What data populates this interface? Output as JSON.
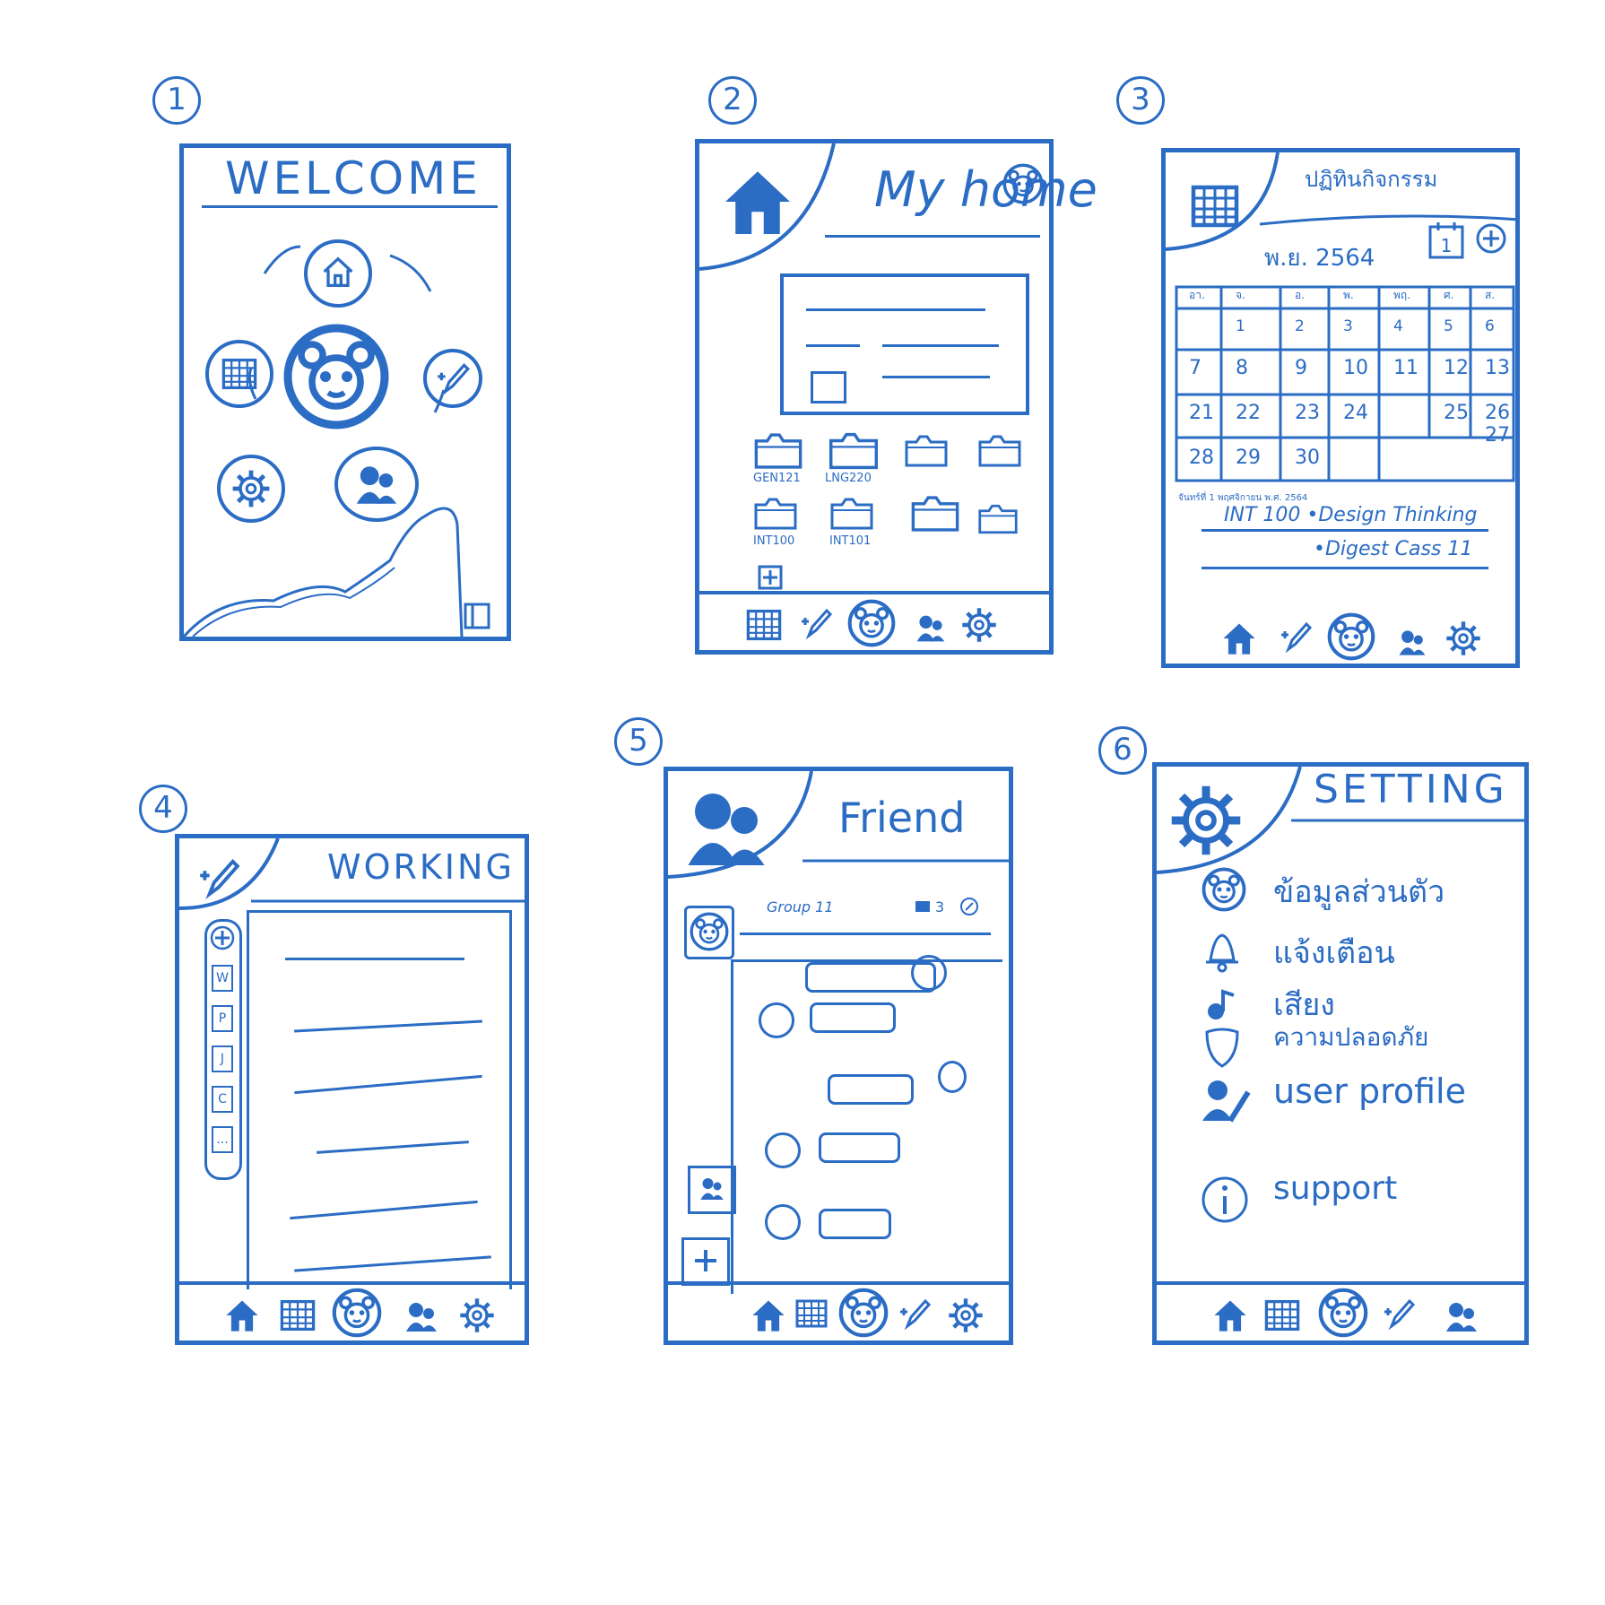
{
  "sketches": [
    {
      "number": "1",
      "title": "WELCOME"
    },
    {
      "number": "2",
      "title": "My home",
      "folders": [
        "GEN121",
        "LNG220",
        "",
        "",
        "INT100",
        "INT101",
        "",
        ""
      ]
    },
    {
      "number": "3",
      "title": "ปฏิทินกิจกรรม",
      "month": "พ.ย. 2564",
      "weekdays": [
        "อา.",
        "จ.",
        "อ.",
        "พ.",
        "พฤ.",
        "ศ.",
        "ส."
      ],
      "days": [
        [
          "",
          "1",
          "2",
          "3",
          "4",
          "5",
          "6"
        ],
        [
          "7",
          "8",
          "9",
          "10",
          "11",
          "12",
          "13"
        ],
        [
          "21",
          "22",
          "23",
          "24",
          "",
          "25",
          "26 27"
        ],
        [
          "28",
          "29",
          "30",
          "",
          "",
          "",
          ""
        ]
      ],
      "note_date": "จันทร์ที่ 1 พฤศจิกายน พ.ศ. 2564",
      "events": [
        "INT 100  •Design Thinking",
        "•Digest Cass 11"
      ]
    },
    {
      "number": "4",
      "title": "WORKING",
      "side_tabs": [
        "W",
        "P",
        "J",
        "C",
        "..."
      ]
    },
    {
      "number": "5",
      "title": "Friend",
      "group": "Group 11",
      "group_count": "3"
    },
    {
      "number": "6",
      "title": "SETTING",
      "items": [
        "ข้อมูลส่วนตัว",
        "แจ้งเตือน",
        "เสียง",
        "ความปลอดภัย",
        "user profile",
        "support"
      ]
    }
  ],
  "icons": {
    "home": "home-icon",
    "calendar": "calendar-icon",
    "edit": "pencil-icon",
    "mascot": "bear-mascot-icon",
    "friends": "friends-icon",
    "settings": "gear-icon"
  },
  "colors": {
    "ink": "#2b6cc4",
    "paper": "#ffffff"
  }
}
